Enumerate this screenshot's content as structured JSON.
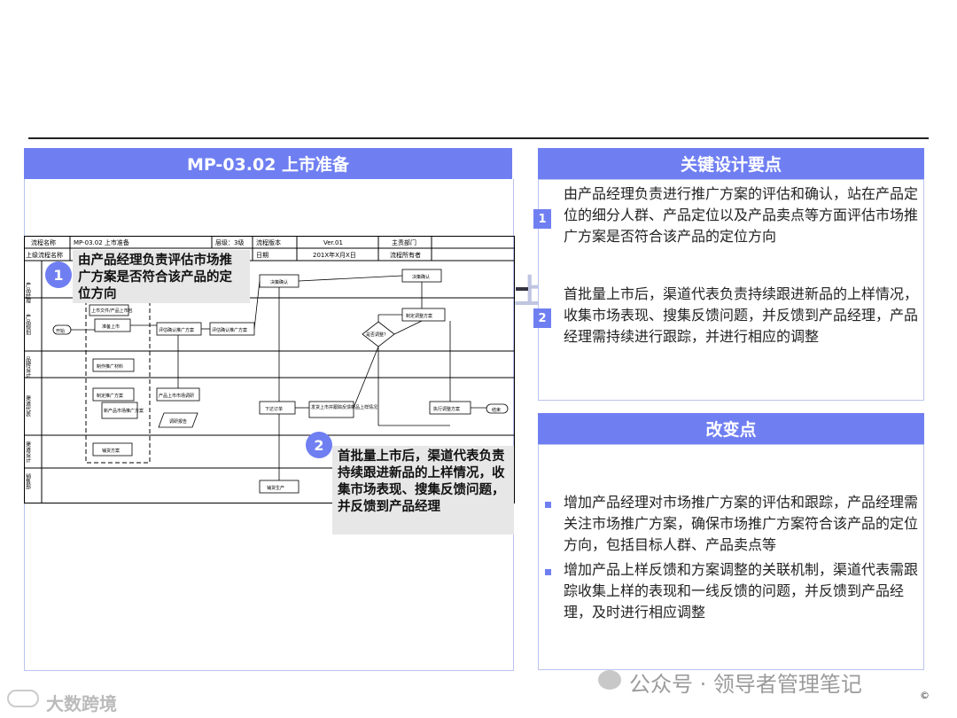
{
  "left_panel": {
    "title": "MP-03.02 上市准备"
  },
  "flow": {
    "header": {
      "name_label": "流程名称",
      "name_value": "MP-03.02 上市准备",
      "level_label": "层级：3级",
      "version_label": "流程版本",
      "version_value": "Ver.01",
      "dept_label": "主责部门",
      "upper_label": "上级流程名称",
      "date_label": "日期",
      "date_value": "201X年X月X日",
      "owner_label": "流程所有者"
    },
    "lanes": [
      "产品经理",
      "产品规划",
      "品牌设计",
      "渠道代表",
      "渠道设计",
      "销售部"
    ],
    "boxes": {
      "start": "开始",
      "prepare": "准备上市",
      "pkg": "上市文件/产品上市包",
      "plan_confirm": "评估确认推广方案",
      "plan_eval": "评估确认推广方案",
      "decide1": "决策确认",
      "decide2": "决策确认",
      "adjust": "制定调整方案",
      "need_adjust": "是否调整？",
      "promo_material": "制作推广材料",
      "promo_plan": "制定推广方案",
      "market_plan": "新产品市场推广方案",
      "market_research": "产品上市市场调研",
      "report": "调研报告",
      "order": "下达订单",
      "ship": "发货上市并跟踪反馈新品上样情况",
      "exec_adjust": "执行调整方案",
      "end": "结束",
      "dist_plan": "铺货方案",
      "sample": "铺货生产"
    }
  },
  "callout1": {
    "num": "1",
    "text": "由产品经理负责评估市场推广方案是否符合该产品的定位方向"
  },
  "callout2": {
    "num": "2",
    "text": "首批量上市后，渠道代表负责持续跟进新品的上样情况，收集市场表现、搜集反馈问题，并反馈到产品经理"
  },
  "ghost_title": "上市准备",
  "key_panel": {
    "title": "关键设计要点",
    "items": [
      {
        "num": "1",
        "text": "由产品经理负责进行推广方案的评估和确认，站在产品定位的细分人群、产品定位以及产品卖点等方面评估市场推广方案是否符合该产品的定位方向"
      },
      {
        "num": "2",
        "text": "首批量上市后，渠道代表负责持续跟进新品的上样情况，收集市场表现、搜集反馈问题，并反馈到产品经理，产品经理需持续进行跟踪，并进行相应的调整"
      }
    ]
  },
  "change_panel": {
    "title": "改变点",
    "items": [
      "增加产品经理对市场推广方案的评估和跟踪，产品经理需关注市场推广方案，确保市场推广方案符合该产品的定位方向，包括目标人群、产品卖点等",
      "增加产品上样反馈和方案调整的关联机制，渠道代表需跟踪收集上样的表现和一线反馈的问题，并反馈到产品经理，及时进行相应调整"
    ]
  },
  "watermarks": {
    "wechat": "公众号 · 领导者管理笔记",
    "logo": "大数跨境",
    "copyright": "©"
  },
  "colors": {
    "accent": "#6f7ff2",
    "callout_bg": "#e7e7e7"
  }
}
